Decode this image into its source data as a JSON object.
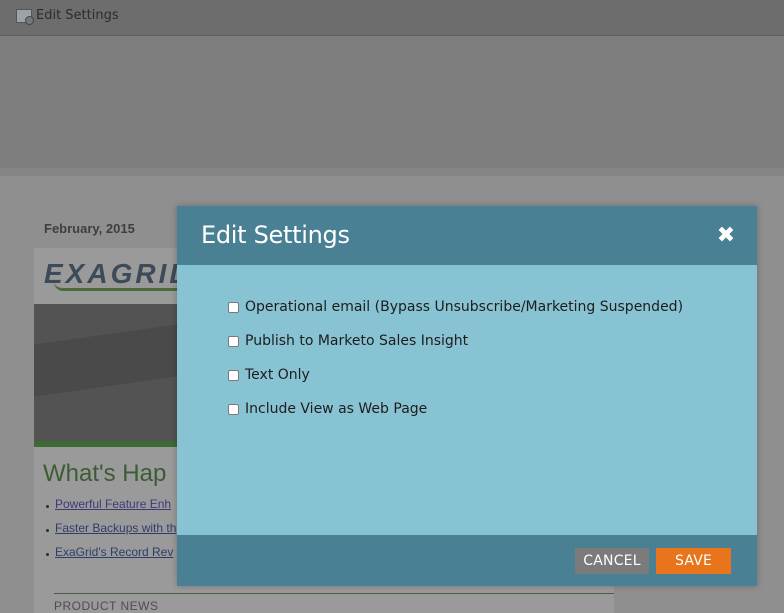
{
  "window": {
    "title": "Edit Settings"
  },
  "background_email": {
    "date": "February, 2015",
    "logo_text": "EXAGRID",
    "headline": "What's Hap",
    "bullets": [
      "Powerful Feature Enh",
      "Faster Backups with th",
      "ExaGrid's Record Rev"
    ],
    "section_label": "PRODUCT NEWS"
  },
  "modal": {
    "title": "Edit Settings",
    "close_icon": "close-icon",
    "options": [
      {
        "label": "Operational email (Bypass Unsubscribe/Marketing Suspended)",
        "checked": false
      },
      {
        "label": "Publish to Marketo Sales Insight",
        "checked": false
      },
      {
        "label": "Text Only",
        "checked": false
      },
      {
        "label": "Include View as Web Page",
        "checked": false
      }
    ],
    "cancel_label": "CANCEL",
    "save_label": "SAVE",
    "colors": {
      "header": "#4a8094",
      "body": "#88c3d3",
      "save": "#e8741c",
      "cancel": "#7b7b7b"
    }
  }
}
